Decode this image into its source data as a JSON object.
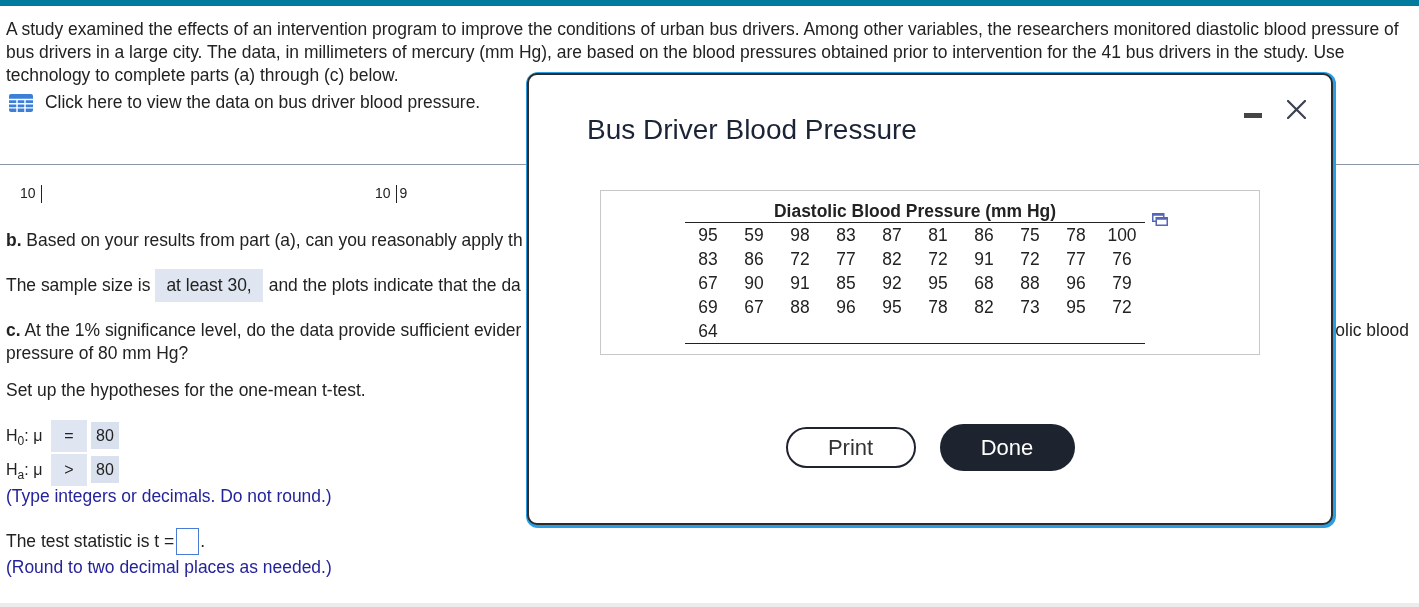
{
  "question": {
    "intro": "A study examined the effects of an intervention program to improve the conditions of urban bus drivers. Among other variables, the researchers monitored diastolic blood pressure of bus drivers in a large city. The data, in millimeters of mercury (mm Hg), are based on the blood pressures obtained prior to intervention for the 41 bus drivers in the study. Use technology to complete parts (a) through (c) below.",
    "data_link": "Click here to view the data on bus driver blood pressure."
  },
  "stemplots": [
    {
      "stem": "10"
    },
    {
      "stem": "10",
      "leaves": "9"
    }
  ],
  "part_b": {
    "question": "**b.** Based on your results from part (a), can you reasonably apply th",
    "answer_before": "The sample size is",
    "answer": "at least 30,",
    "answer_after": "and the plots indicate that the da"
  },
  "part_c": {
    "question": "**c.** At the 1% significance level, do the data provide sufficient evider",
    "question_right": "olic blood",
    "question_cont": "pressure of 80 mm Hg?",
    "prompt": "Set up the hypotheses for the one-mean t-test.",
    "hypotheses": [
      {
        "label": "H$_{0}$: μ",
        "relation": "=",
        "value": "80"
      },
      {
        "label": "H$_{a}$: μ",
        "relation": ">",
        "value": "80"
      }
    ],
    "hint": "(Type integers or decimals. Do not round.)",
    "statistic_label": "The test statistic is t =",
    "statistic_suffix": ".",
    "statistic_hint": "(Round to two decimal places as needed.)"
  },
  "dialog": {
    "title": "Bus Driver Blood Pressure",
    "table": {
      "title": "Diastolic Blood Pressure (mm Hg)",
      "rows": [
        [
          "95",
          "59",
          "98",
          "83",
          "87",
          "81",
          "86",
          "75",
          "78",
          "100"
        ],
        [
          "83",
          "86",
          "72",
          "77",
          "82",
          "72",
          "91",
          "72",
          "77",
          "76"
        ],
        [
          "67",
          "90",
          "91",
          "85",
          "92",
          "95",
          "68",
          "88",
          "96",
          "79"
        ],
        [
          "69",
          "67",
          "88",
          "96",
          "95",
          "78",
          "82",
          "73",
          "95",
          "72"
        ],
        [
          "64"
        ]
      ]
    },
    "buttons": [
      {
        "label": "Print",
        "kind": "secondary"
      },
      {
        "label": "Done",
        "kind": "primary"
      }
    ]
  }
}
